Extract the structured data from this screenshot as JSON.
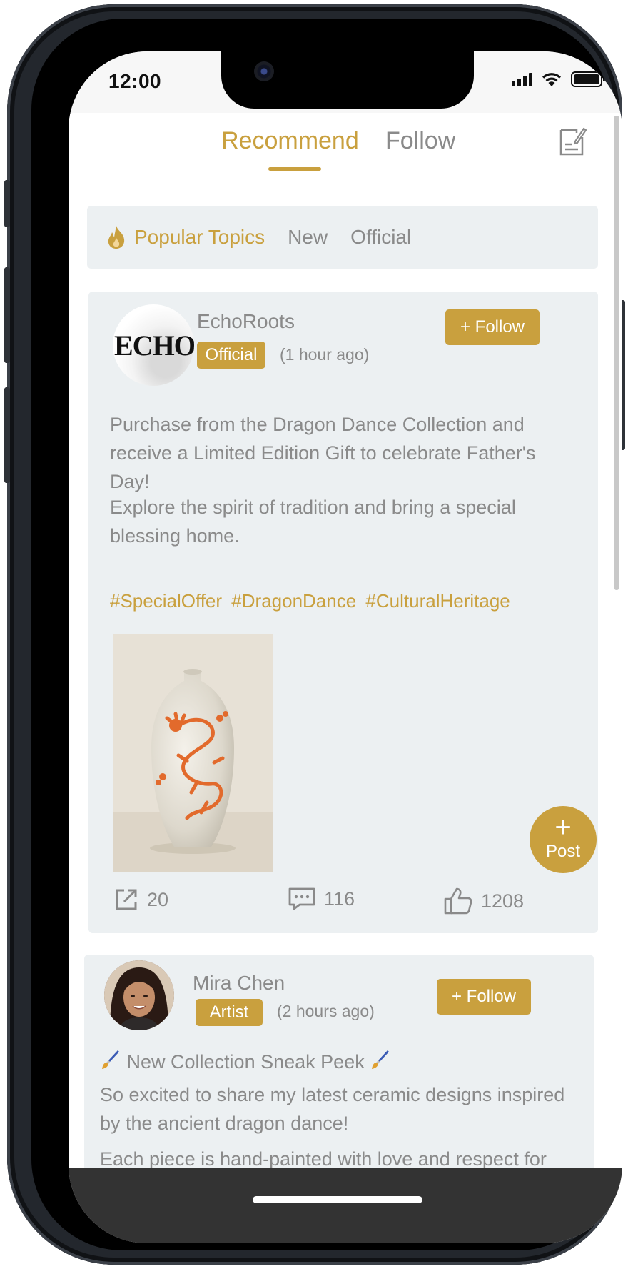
{
  "status_bar": {
    "time": "12:00"
  },
  "nav": {
    "tabs": [
      {
        "label": "Recommend",
        "active": true
      },
      {
        "label": "Follow",
        "active": false
      }
    ],
    "compose_icon": "edit-note-icon"
  },
  "topics": {
    "items": [
      {
        "label": "Popular Topics",
        "active": true,
        "icon": "flame-icon"
      },
      {
        "label": "New",
        "active": false
      },
      {
        "label": "Official",
        "active": false
      }
    ]
  },
  "posts": [
    {
      "author": "EchoRoots",
      "avatar_text": "ECHO",
      "badge": "Official",
      "time_ago": "(1 hour ago)",
      "follow_label": "+ Follow",
      "paragraphs": [
        "Purchase from the Dragon Dance Collection and receive a Limited Edition Gift to celebrate Father's Day!",
        "Explore the spirit of tradition and bring a special blessing home."
      ],
      "hashtags": [
        "#SpecialOffer",
        "#DragonDance",
        "#CulturalHeritage"
      ],
      "image": "white porcelain vase with orange dragon",
      "stats": {
        "shares": "20",
        "comments": "116",
        "likes": "1208"
      }
    },
    {
      "author": "Mira Chen",
      "badge": "Artist",
      "time_ago": "(2 hours ago)",
      "follow_label": "+ Follow",
      "headline": "New Collection Sneak Peek",
      "headline_icon": "paintbrush-icon",
      "paragraphs": [
        "So excited to share my latest ceramic designs inspired by the ancient dragon dance!",
        "Each piece is hand-painted with love and respect for tradition."
      ]
    }
  ],
  "fab": {
    "plus": "+",
    "label": "Post"
  },
  "colors": {
    "accent": "#c9a03e",
    "card_bg": "#ecf0f2",
    "muted_text": "#8a8a8a"
  }
}
